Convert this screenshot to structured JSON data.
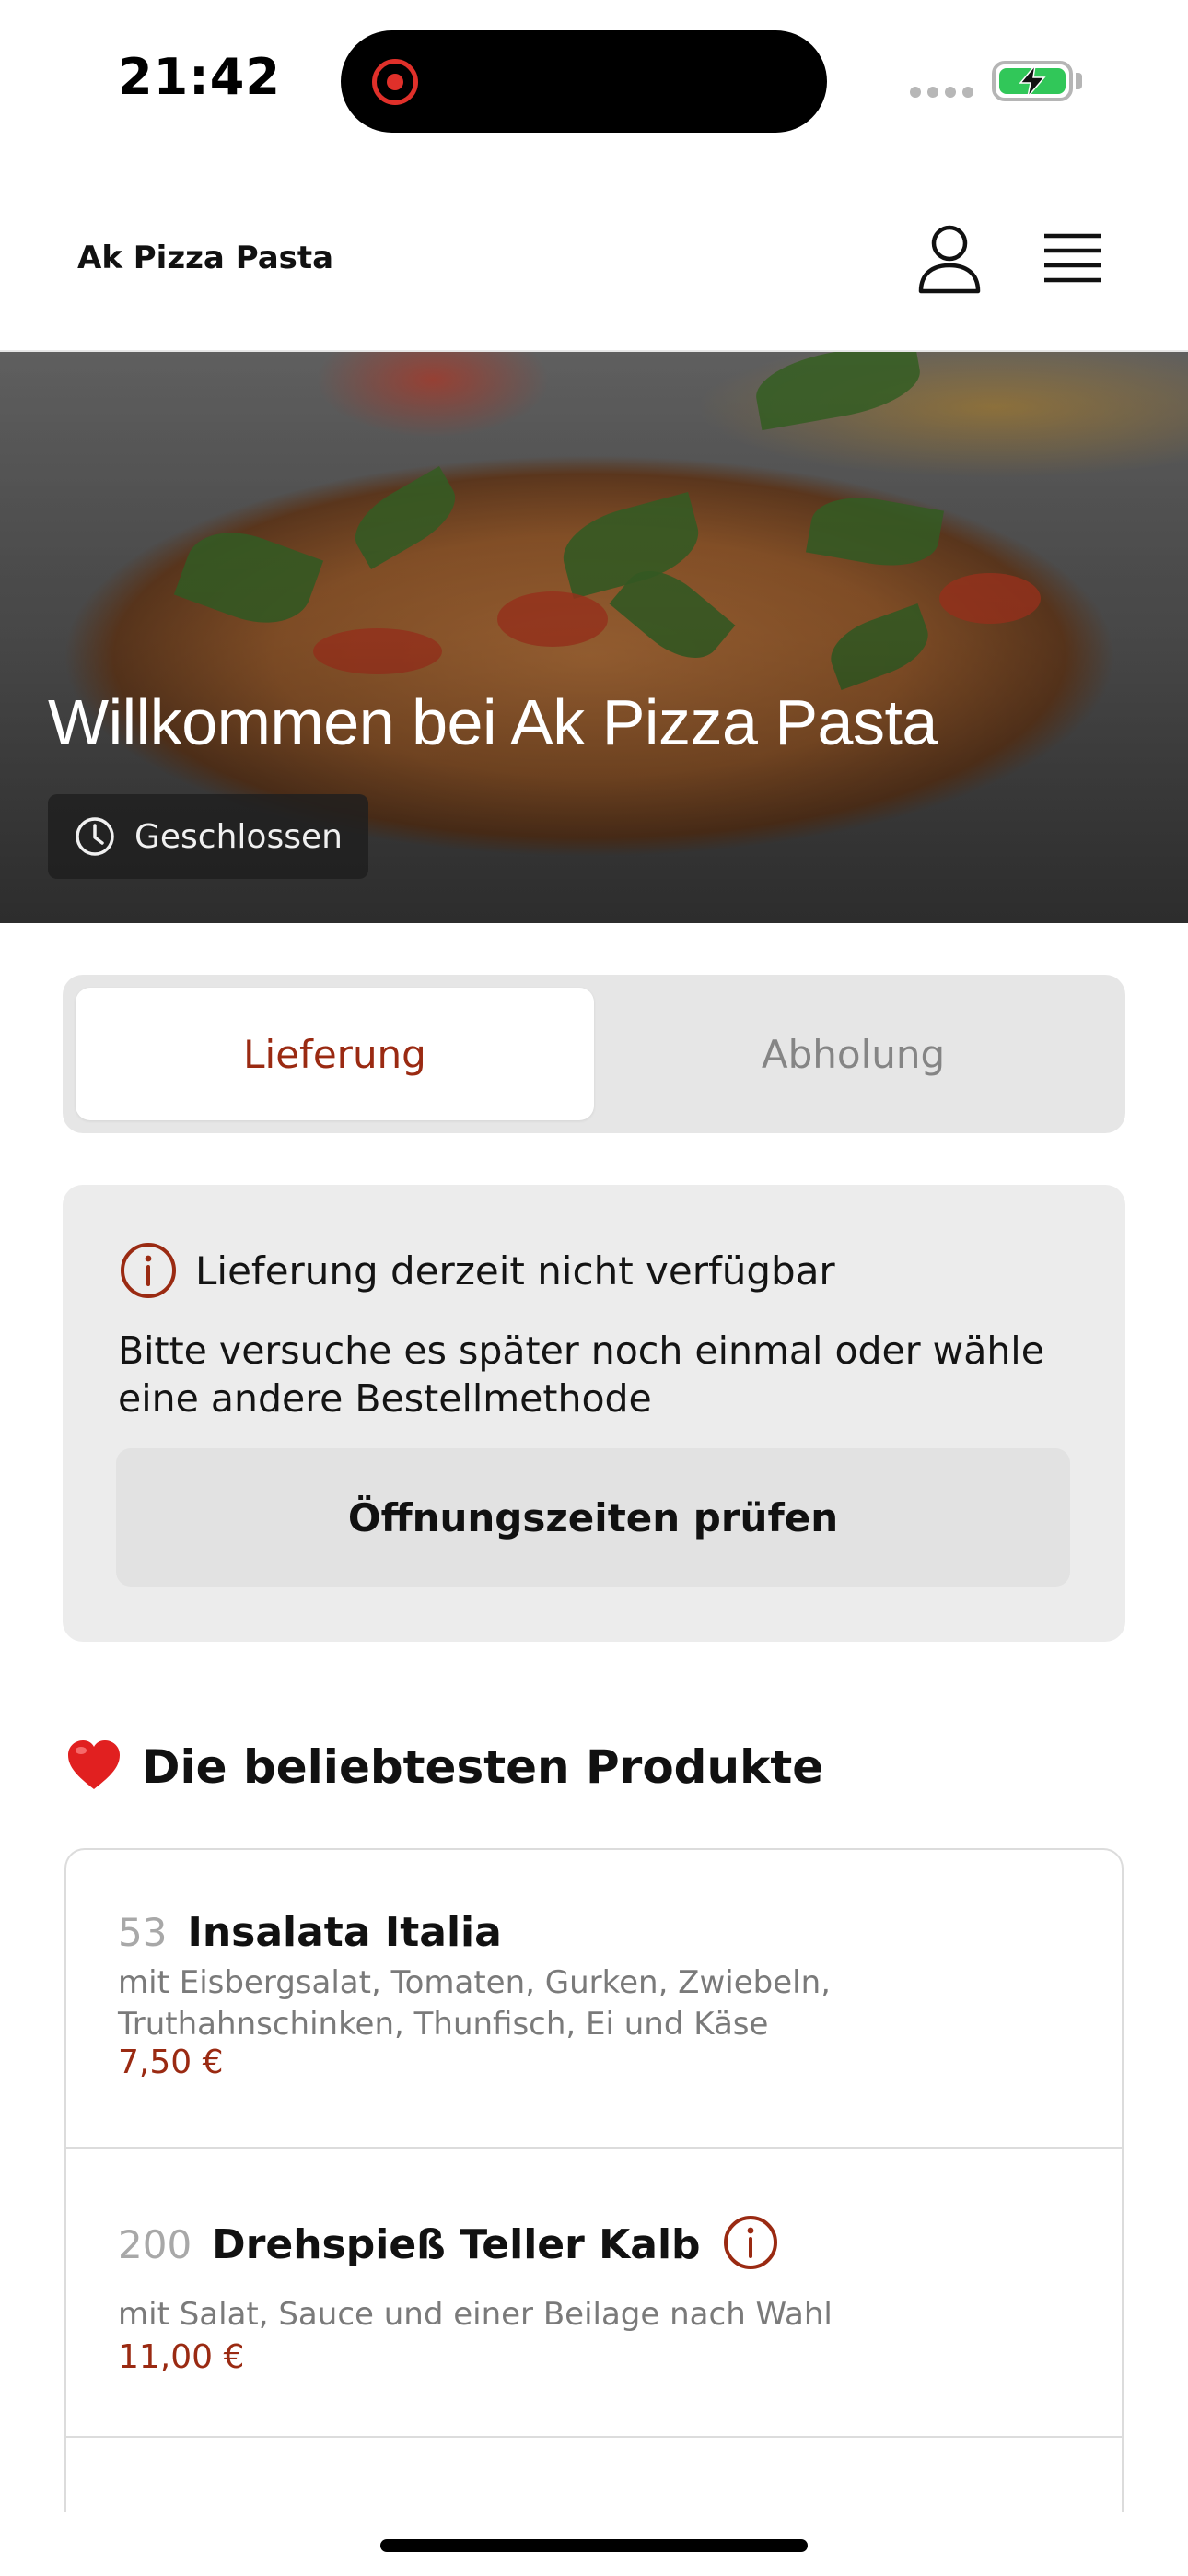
{
  "status_bar": {
    "time": "21:42",
    "icons": [
      "screen-recording-icon",
      "signal-icon",
      "battery-charging-icon"
    ]
  },
  "header": {
    "brand": "Ak Pizza Pasta",
    "icons": [
      "profile-icon",
      "menu-icon"
    ]
  },
  "hero": {
    "title": "Willkommen bei Ak Pizza Pasta",
    "status": "Geschlossen",
    "status_icon": "clock-icon"
  },
  "order_mode": {
    "tabs": [
      {
        "label": "Lieferung",
        "active": true
      },
      {
        "label": "Abholung",
        "active": false
      }
    ]
  },
  "notice": {
    "icon": "info-icon",
    "title": "Lieferung derzeit nicht verfügbar",
    "text": "Bitte versuche es später noch einmal oder wähle eine andere Bestellmethode",
    "button": "Öffnungszeiten prüfen"
  },
  "popular": {
    "emoji": "❤️",
    "title": "Die beliebtesten Produkte",
    "items": [
      {
        "number": "53",
        "name": "Insalata Italia",
        "description": "mit Eisbergsalat, Tomaten, Gurken, Zwiebeln, Truthahnschinken, Thunfisch, Ei und Käse",
        "price": "7,50 €",
        "info_icon": false
      },
      {
        "number": "200",
        "name": "Drehspieß Teller Kalb",
        "description": "mit Salat, Sauce und einer Beilage nach Wahl",
        "price": "11,00 €",
        "info_icon": true
      }
    ]
  },
  "colors": {
    "accent": "#9a2a12",
    "toggle_bg": "#e6e6e6",
    "notice_bg": "#ececec",
    "battery": "#31c759",
    "recording": "#e0302a"
  }
}
